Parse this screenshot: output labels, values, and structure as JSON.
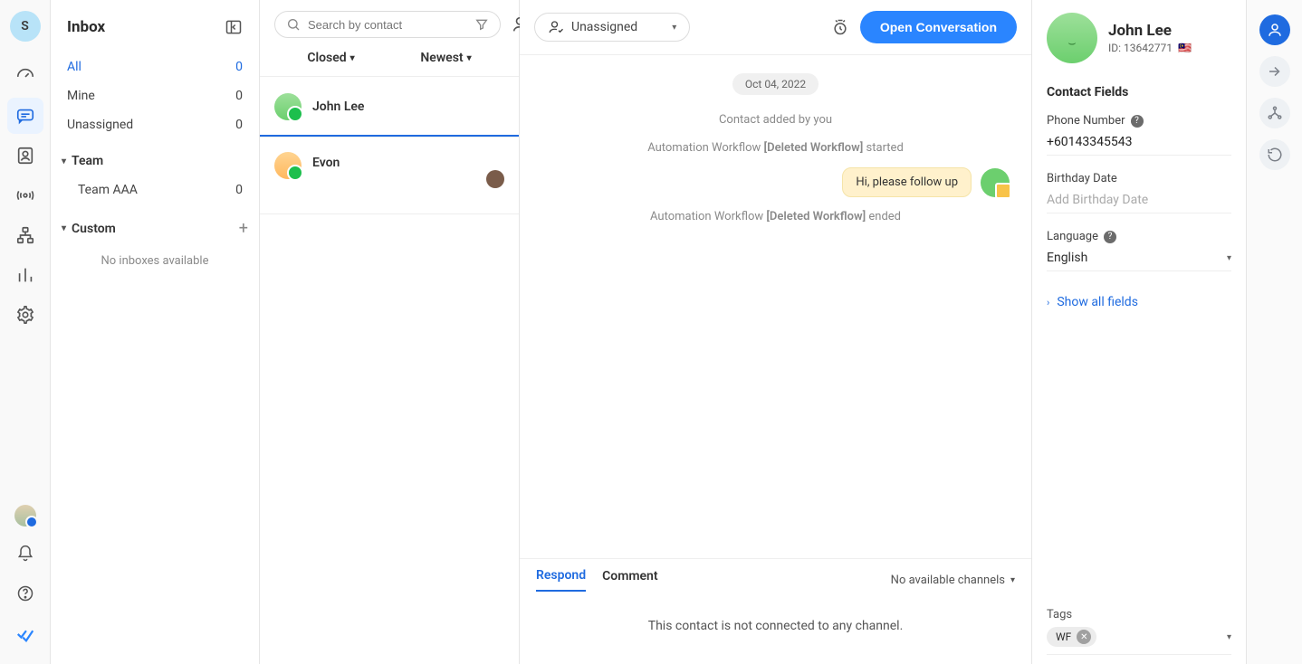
{
  "nav": {
    "workspace_initial": "S"
  },
  "inbox": {
    "title": "Inbox",
    "items": [
      {
        "label": "All",
        "count": "0"
      },
      {
        "label": "Mine",
        "count": "0"
      },
      {
        "label": "Unassigned",
        "count": "0"
      }
    ],
    "team_label": "Team",
    "team_items": [
      {
        "label": "Team AAA",
        "count": "0"
      }
    ],
    "custom_label": "Custom",
    "custom_empty": "No inboxes available"
  },
  "conv_list": {
    "search_placeholder": "Search by contact",
    "filters": {
      "status": "Closed",
      "sort": "Newest"
    },
    "items": [
      {
        "name": "John Lee"
      },
      {
        "name": "Evon"
      }
    ]
  },
  "chat": {
    "assignee": "Unassigned",
    "open_button": "Open Conversation",
    "date": "Oct 04, 2022",
    "events": {
      "added": "Contact added by you",
      "wf_start_pre": "Automation Workflow ",
      "wf_start_mid": "[Deleted Workflow]",
      "wf_start_post": " started",
      "wf_end_pre": "Automation Workflow ",
      "wf_end_mid": "[Deleted Workflow]",
      "wf_end_post": " ended"
    },
    "message": "Hi, please follow up",
    "composer": {
      "tabs": {
        "respond": "Respond",
        "comment": "Comment"
      },
      "channel_label": "No available channels",
      "empty_text": "This contact is not connected to any channel."
    }
  },
  "contact": {
    "name": "John Lee",
    "id_label": "ID: 13642771",
    "flag_emoji": "🇲🇾",
    "section_title": "Contact Fields",
    "fields": {
      "phone_label": "Phone Number",
      "phone_value": "+60143345543",
      "birthday_label": "Birthday Date",
      "birthday_placeholder": "Add Birthday Date",
      "language_label": "Language",
      "language_value": "English"
    },
    "show_all": "Show all fields",
    "tags_label": "Tags",
    "tags": [
      "WF"
    ]
  }
}
